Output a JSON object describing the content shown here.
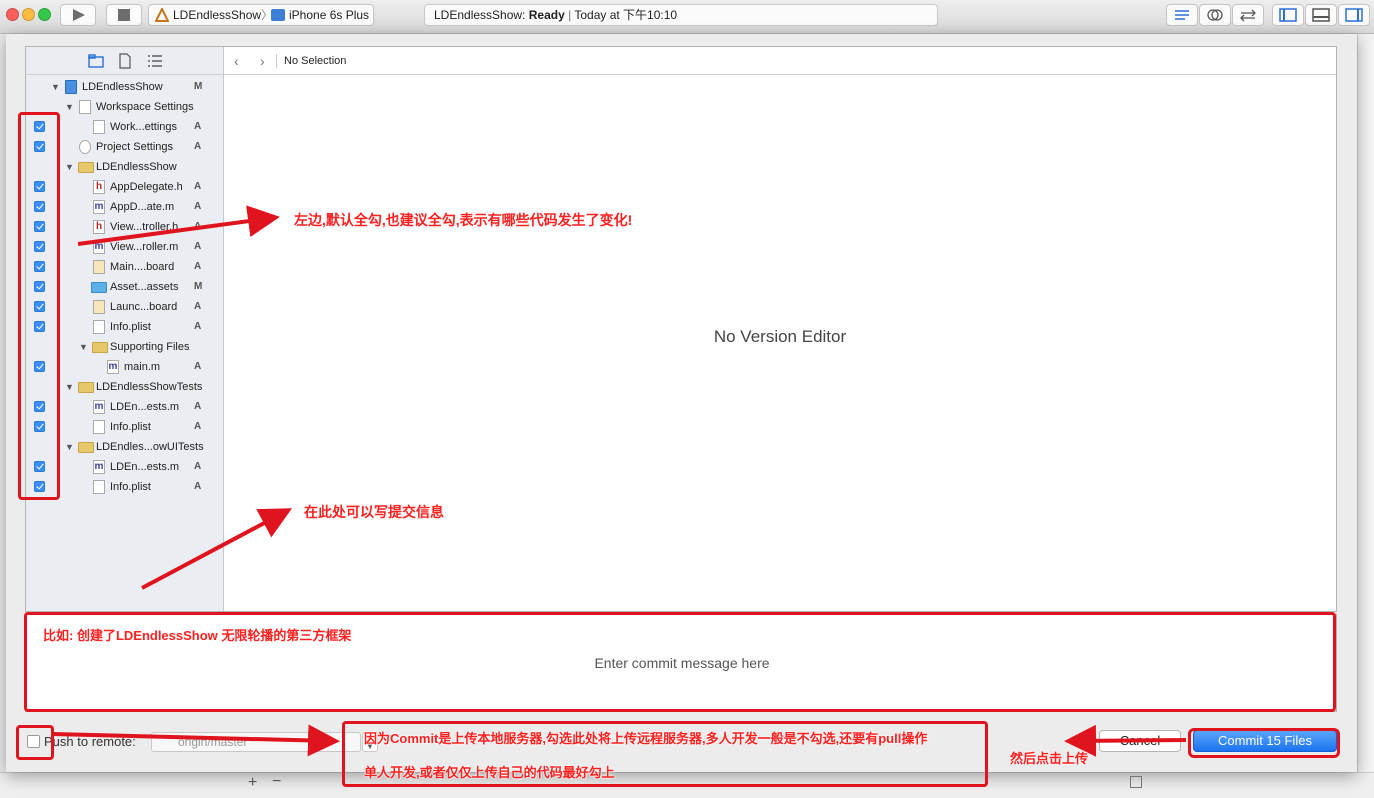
{
  "toolbar": {
    "scheme_project": "LDEndlessShow",
    "scheme_device": "iPhone 6s Plus",
    "status_project": "LDEndlessShow:",
    "status_state": "Ready",
    "status_time": "Today at 下午10:10"
  },
  "navigator": {
    "rows": [
      {
        "label": "LDEndlessShow",
        "status": "M"
      },
      {
        "label": "Workspace Settings",
        "status": ""
      },
      {
        "label": "Work...ettings",
        "status": "A"
      },
      {
        "label": "Project Settings",
        "status": "A"
      },
      {
        "label": "LDEndlessShow",
        "status": ""
      },
      {
        "label": "AppDelegate.h",
        "status": "A"
      },
      {
        "label": "AppD...ate.m",
        "status": "A"
      },
      {
        "label": "View...troller.h",
        "status": "A"
      },
      {
        "label": "View...roller.m",
        "status": "A"
      },
      {
        "label": "Main....board",
        "status": "A"
      },
      {
        "label": "Asset...assets",
        "status": "M"
      },
      {
        "label": "Launc...board",
        "status": "A"
      },
      {
        "label": "Info.plist",
        "status": "A"
      },
      {
        "label": "Supporting Files",
        "status": ""
      },
      {
        "label": "main.m",
        "status": "A"
      },
      {
        "label": "LDEndlessShowTests",
        "status": ""
      },
      {
        "label": "LDEn...ests.m",
        "status": "A"
      },
      {
        "label": "Info.plist",
        "status": "A"
      },
      {
        "label": "LDEndles...owUITests",
        "status": ""
      },
      {
        "label": "LDEn...ests.m",
        "status": "A"
      },
      {
        "label": "Info.plist",
        "status": "A"
      }
    ]
  },
  "editor": {
    "jump_label": "No Selection",
    "empty_label": "No Version Editor"
  },
  "commit": {
    "placeholder": "Enter commit message here"
  },
  "push": {
    "label": "Push to remote:",
    "remote": "origin/master"
  },
  "buttons": {
    "cancel": "Cancel",
    "commit": "Commit 15 Files"
  },
  "annotations": {
    "left": "左边,默认全勾,也建议全勾,表示有哪些代码发生了变化!",
    "message_hint": "在此处可以写提交信息",
    "message_example": "比如: 创建了LDEndlessShow 无限轮播的第三方框架",
    "push_line1": "因为Commit是上传本地服务器,勾选此处将上传远程服务器,多人开发一般是不勾选,还要有pull操作",
    "push_line2": "单人开发,或者仅仅上传自己的代码最好勾上",
    "commit_hint": "然后点击上传"
  },
  "colors": {
    "annotation": "#e0141e",
    "accent": "#1b73f0",
    "checkbox": "#3a8ef7"
  }
}
